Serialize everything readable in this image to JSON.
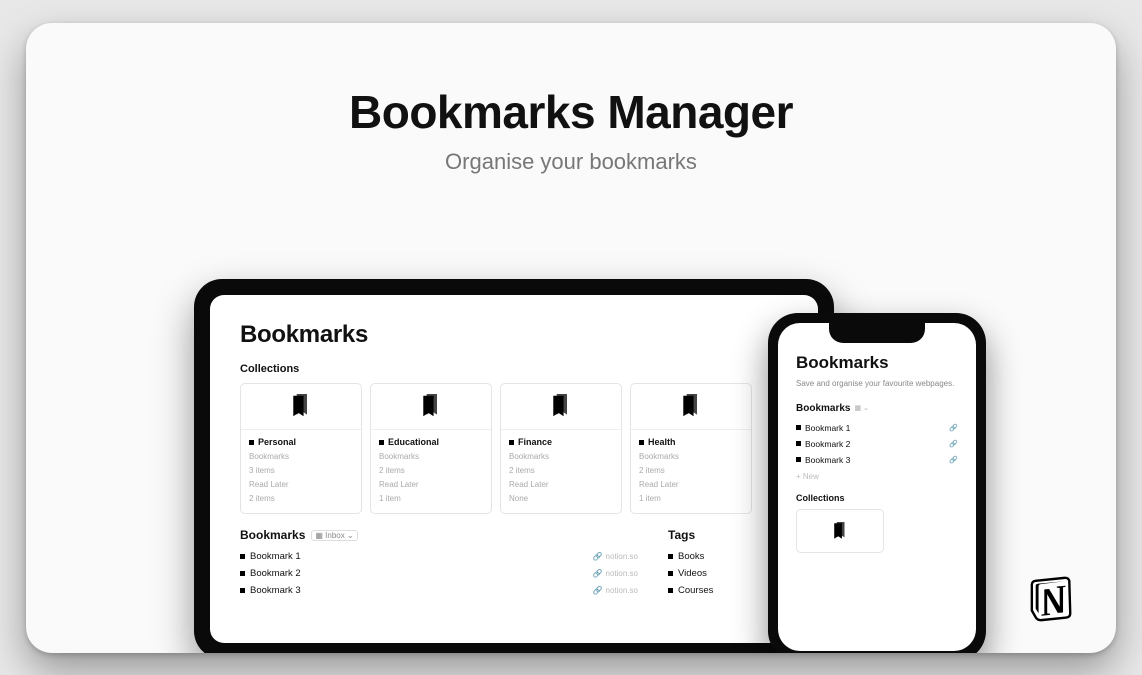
{
  "hero": {
    "title": "Bookmarks Manager",
    "subtitle": "Organise your bookmarks"
  },
  "tablet": {
    "heading": "Bookmarks",
    "collections_label": "Collections",
    "collections": [
      {
        "name": "Personal",
        "line1": "Bookmarks",
        "line2": "3 items",
        "line3": "Read Later",
        "line4": "2 items"
      },
      {
        "name": "Educational",
        "line1": "Bookmarks",
        "line2": "2 items",
        "line3": "Read Later",
        "line4": "1 item"
      },
      {
        "name": "Finance",
        "line1": "Bookmarks",
        "line2": "2 items",
        "line3": "Read Later",
        "line4": "None"
      },
      {
        "name": "Health",
        "line1": "Bookmarks",
        "line2": "2 items",
        "line3": "Read Later",
        "line4": "1 item"
      }
    ],
    "bookmarks_label": "Bookmarks",
    "bookmarks_view": "Inbox",
    "bookmarks": [
      {
        "title": "Bookmark 1",
        "source": "notion.so"
      },
      {
        "title": "Bookmark 2",
        "source": "notion.so"
      },
      {
        "title": "Bookmark 3",
        "source": "notion.so"
      }
    ],
    "tags_label": "Tags",
    "tags": [
      {
        "title": "Books"
      },
      {
        "title": "Videos"
      },
      {
        "title": "Courses"
      }
    ]
  },
  "phone": {
    "heading": "Bookmarks",
    "description": "Save and organise your favourite webpages.",
    "bookmarks_label": "Bookmarks",
    "bookmarks": [
      {
        "title": "Bookmark 1"
      },
      {
        "title": "Bookmark 2"
      },
      {
        "title": "Bookmark 3"
      }
    ],
    "new_label": "+  New",
    "collections_label": "Collections"
  }
}
